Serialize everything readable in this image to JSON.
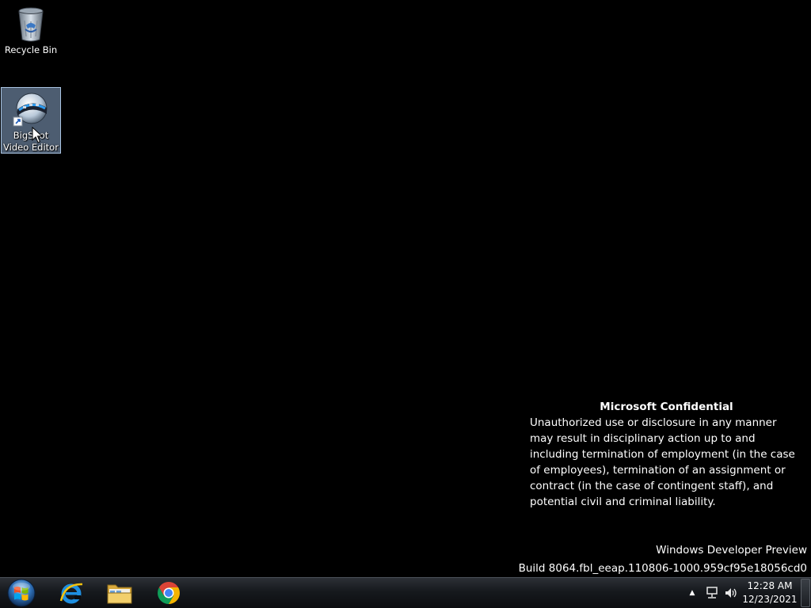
{
  "desktop": {
    "icons": [
      {
        "label": "Recycle Bin",
        "icon": "recycle-bin-icon"
      },
      {
        "label": "BigShot Video Editor",
        "icon": "bigshot-video-editor-icon",
        "selected": true,
        "shortcut": true
      }
    ]
  },
  "watermark": {
    "title": "Microsoft Confidential",
    "body": "Unauthorized use or disclosure in any manner may result in disciplinary action up to and including termination of employment (in the case of employees), termination of an assignment or contract (in the case of contingent staff), and potential civil and criminal liability."
  },
  "build": {
    "edition": "Windows Developer Preview",
    "build_string": "Build 8064.fbl_eeap.110806-1000.959cf95e18056cd0"
  },
  "taskbar": {
    "start_icon": "windows-start-orb-icon",
    "pinned": [
      {
        "name": "Internet Explorer",
        "icon": "internet-explorer-icon"
      },
      {
        "name": "Windows Explorer",
        "icon": "file-explorer-folder-icon"
      },
      {
        "name": "Google Chrome",
        "icon": "chrome-icon"
      }
    ],
    "tray": {
      "arrow": "▲",
      "network_icon": "network-icon",
      "volume_icon": "volume-icon"
    },
    "clock": {
      "time": "12:28 AM",
      "date": "12/23/2021"
    }
  },
  "colors": {
    "desktop_background": "#000000",
    "selection": "#8caacd",
    "chrome_red": "#db4437",
    "chrome_green": "#0f9d58",
    "chrome_yellow": "#f4b400",
    "chrome_blue": "#4285f4",
    "ie_blue": "#1e8fe1"
  }
}
